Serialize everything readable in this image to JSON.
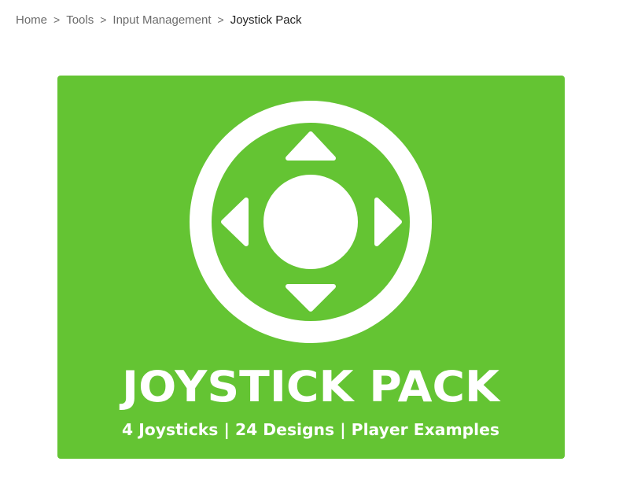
{
  "breadcrumb": {
    "items": [
      {
        "label": "Home"
      },
      {
        "label": "Tools"
      },
      {
        "label": "Input Management"
      }
    ],
    "separator": ">",
    "current": "Joystick Pack"
  },
  "hero": {
    "background_color": "#64c433",
    "foreground_color": "#ffffff",
    "title": "JOYSTICK PACK",
    "subtitle": "4 Joysticks | 24 Designs | Player Examples"
  }
}
